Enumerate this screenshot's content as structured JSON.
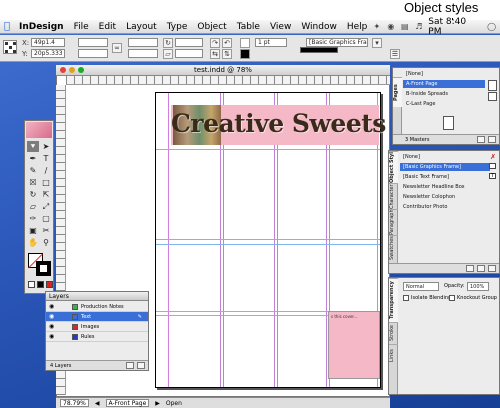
{
  "callout": {
    "label": "Object styles"
  },
  "menubar": {
    "app": "InDesign",
    "items": [
      "File",
      "Edit",
      "Layout",
      "Type",
      "Object",
      "Table",
      "View",
      "Window",
      "Help"
    ],
    "clock": "Sat 8:40 PM"
  },
  "control": {
    "x_label": "X:",
    "x_value": "49p1.4",
    "y_label": "Y:",
    "y_value": "20p5.333",
    "stroke_weight": "1 pt",
    "object_style": "[Basic Graphics Frame]"
  },
  "document": {
    "title": "test.indd @ 78%",
    "banner_text": "Creative Sweets",
    "pink_box_text": "s this cover..."
  },
  "statusbar": {
    "zoom": "78.79%",
    "page": "A-Front Page",
    "status": "Open"
  },
  "pages_panel": {
    "tab": "Pages",
    "items": [
      "[None]",
      "A-Front Page",
      "B-Inside Spreads",
      "C-Last Page"
    ],
    "footer": "3 Masters"
  },
  "object_styles_panel": {
    "tabs": [
      "Object Styles",
      "Character",
      "Paragraph",
      "Swatches"
    ],
    "items": [
      "[None]",
      "[Basic Graphics Frame]",
      "[Basic Text Frame]",
      "Newsletter Headline Box",
      "Newsletter Colophon",
      "Contributor Photo"
    ]
  },
  "transparency_panel": {
    "tabs": [
      "Transparency",
      "Stroke",
      "Links"
    ],
    "mode": "Normal",
    "opacity_label": "Opacity:",
    "opacity": "100%",
    "isolate_label": "Isolate Blending",
    "knockout_label": "Knockout Group"
  },
  "layers_panel": {
    "title": "Layers",
    "layers": [
      {
        "name": "Production Notes",
        "color": "#3cb14a"
      },
      {
        "name": "Text",
        "color": "#3a6fd8"
      },
      {
        "name": "Images",
        "color": "#d22a2a"
      },
      {
        "name": "Rules",
        "color": "#2a3ab8"
      }
    ],
    "footer": "4 Layers"
  },
  "colors": {
    "page_pink": "#f4b8c6",
    "selection": "#3a6fd8"
  }
}
